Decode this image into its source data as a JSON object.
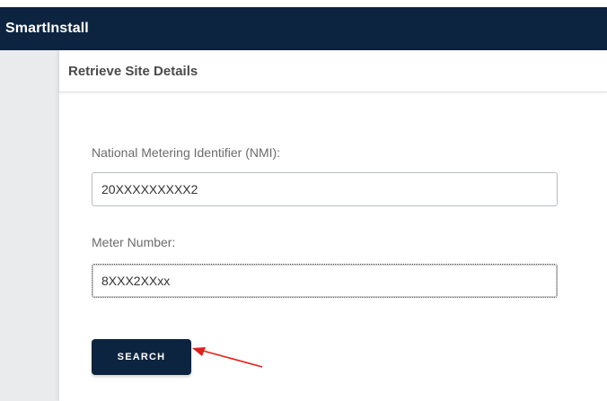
{
  "app": {
    "title": "SmartInstall",
    "colors": {
      "appbar": "#0d2440",
      "button": "#0d2440",
      "annotation_arrow": "#e0201b"
    }
  },
  "panel": {
    "title": "Retrieve Site Details"
  },
  "form": {
    "nmi": {
      "label": "National Metering Identifier (NMI):",
      "value": "20XXXXXXXXX2"
    },
    "meter_number": {
      "label": "Meter Number:",
      "value": "8XXX2XXxx"
    },
    "search_label": "SEARCH"
  },
  "annotation": {
    "icon": "red-arrow-icon",
    "points_to": "search-button"
  }
}
